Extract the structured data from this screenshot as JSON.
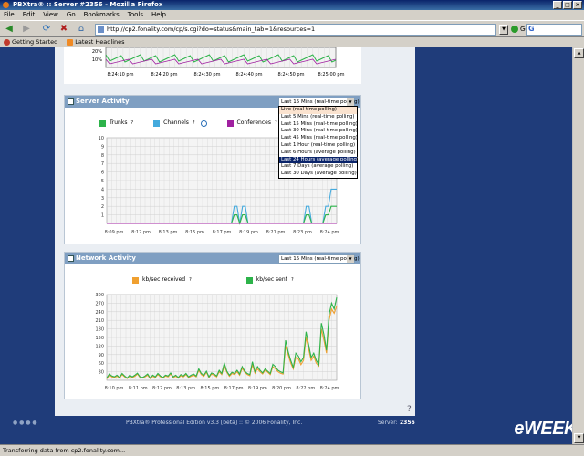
{
  "window": {
    "title": "PBXtra® :: Server #2356 - Mozilla Firefox"
  },
  "menu": [
    "File",
    "Edit",
    "View",
    "Go",
    "Bookmarks",
    "Tools",
    "Help"
  ],
  "toolbar": {
    "url": "http://cp2.fonality.com/cp/s.cgi?do=status&main_tab=1&resources=1",
    "go_label": "Go",
    "search_logo": "G"
  },
  "bookmarks": [
    {
      "label": "Getting Started",
      "icon": "firefox-icon"
    },
    {
      "label": "Latest Headlines",
      "icon": "rss-icon"
    }
  ],
  "top_chart": {
    "yticks": [
      "20%",
      "10%"
    ],
    "xticks": [
      "8:24:10 pm",
      "8:24:20 pm",
      "8:24:30 pm",
      "8:24:40 pm",
      "8:24:50 pm",
      "8:25:00 pm"
    ]
  },
  "server_activity": {
    "title": "Server Activity",
    "select_value": "Last 15 Mins (real-time polling)",
    "legend": [
      {
        "label": "Trunks",
        "color": "#2db34a",
        "help": "?"
      },
      {
        "label": "Channels",
        "color": "#44aadd",
        "help": "?"
      },
      {
        "label": "Conferences",
        "color": "#a020a0",
        "help": "?"
      }
    ],
    "dropdown_options": [
      "Live (real-time polling)",
      "Last 5 Mins (real-time polling)",
      "Last 15 Mins (real-time polling)",
      "Last 30 Mins (real-time polling)",
      "Last 45 Mins (real-time polling)",
      "Last 1 Hour (real-time polling)",
      "Last 6 Hours (average polling)",
      "Last 24 Hours (average polling)",
      "Last 7 Days (average polling)",
      "Last 30 Days (average polling)"
    ],
    "dropdown_selected_index": 7,
    "chart": {
      "ylim": [
        0,
        10
      ],
      "yticks": [
        "10",
        "9",
        "8",
        "7",
        "6",
        "5",
        "4",
        "3",
        "2",
        "1"
      ],
      "xticks": [
        "8:09 pm",
        "8:12 pm",
        "8:13 pm",
        "8:15 pm",
        "8:17 pm",
        "8:19 pm",
        "8:21 pm",
        "8:23 pm",
        "8:24 pm"
      ],
      "series": [
        {
          "name": "Channels",
          "color": "#44aadd",
          "values": [
            0,
            0,
            0,
            0,
            0,
            0,
            0,
            0,
            0,
            0,
            0,
            0,
            0,
            0,
            0,
            0,
            0,
            0,
            0,
            0,
            0,
            0,
            0,
            0,
            0,
            0,
            0,
            0,
            0,
            0,
            0,
            0,
            0,
            0,
            0,
            0,
            0,
            0,
            0,
            0,
            0,
            0,
            0,
            0,
            0,
            0,
            2,
            2,
            0,
            2,
            2,
            0,
            0,
            0,
            0,
            0,
            0,
            0,
            0,
            0,
            0,
            0,
            0,
            0,
            0,
            0,
            0,
            0,
            0,
            0,
            0,
            0,
            2,
            2,
            0,
            0,
            0,
            0,
            0,
            2,
            2,
            4,
            4,
            4
          ]
        },
        {
          "name": "Trunks",
          "color": "#2db34a",
          "values": [
            0,
            0,
            0,
            0,
            0,
            0,
            0,
            0,
            0,
            0,
            0,
            0,
            0,
            0,
            0,
            0,
            0,
            0,
            0,
            0,
            0,
            0,
            0,
            0,
            0,
            0,
            0,
            0,
            0,
            0,
            0,
            0,
            0,
            0,
            0,
            0,
            0,
            0,
            0,
            0,
            0,
            0,
            0,
            0,
            0,
            0,
            1,
            1,
            0,
            1,
            1,
            0,
            0,
            0,
            0,
            0,
            0,
            0,
            0,
            0,
            0,
            0,
            0,
            0,
            0,
            0,
            0,
            0,
            0,
            0,
            0,
            0,
            1,
            1,
            0,
            0,
            0,
            0,
            0,
            1,
            1,
            2,
            2,
            2
          ]
        },
        {
          "name": "Conferences",
          "color": "#a020a0",
          "values": [
            0,
            0,
            0,
            0,
            0,
            0,
            0,
            0,
            0,
            0,
            0,
            0,
            0,
            0,
            0,
            0,
            0,
            0,
            0,
            0,
            0,
            0,
            0,
            0,
            0,
            0,
            0,
            0,
            0,
            0,
            0,
            0,
            0,
            0,
            0,
            0,
            0,
            0,
            0,
            0,
            0,
            0,
            0,
            0,
            0,
            0,
            0,
            0,
            0,
            0,
            0,
            0,
            0,
            0,
            0,
            0,
            0,
            0,
            0,
            0,
            0,
            0,
            0,
            0,
            0,
            0,
            0,
            0,
            0,
            0,
            0,
            0,
            0,
            0,
            0,
            0,
            0,
            0,
            0,
            0,
            0,
            0,
            0,
            0
          ]
        }
      ]
    }
  },
  "network_activity": {
    "title": "Network Activity",
    "select_value": "Last 15 Mins (real-time polling)",
    "legend": [
      {
        "label": "kb/sec received",
        "color": "#f0a030",
        "help": "?"
      },
      {
        "label": "kb/sec sent",
        "color": "#2db34a",
        "help": "?"
      }
    ]
  },
  "footer": {
    "edition": "PBXtra® Professional Edition v3.3 [beta]  ::  © 2006 Fonality, Inc.",
    "server_label": "Server:",
    "server_number": "2356",
    "watermark": "eWEEK"
  },
  "status": {
    "text": "Transferring data from cp2.fonality.com..."
  },
  "chart_data": {
    "type": "line",
    "title": "",
    "xlabel": "",
    "ylabel": "",
    "ylim": [
      0,
      300
    ],
    "yticks": [
      "300",
      "270",
      "240",
      "210",
      "180",
      "150",
      "120",
      "90",
      "60",
      "30"
    ],
    "categories": [
      "8:10 pm",
      "8:11 pm",
      "8:12 pm",
      "8:13 pm",
      "8:15 pm",
      "8:17 pm",
      "8:19 pm",
      "8:20 pm",
      "8:22 pm",
      "8:24 pm"
    ],
    "series": [
      {
        "name": "kb/sec received",
        "color": "#f0a030",
        "values": [
          5,
          18,
          12,
          10,
          14,
          8,
          20,
          12,
          6,
          15,
          10,
          14,
          22,
          10,
          8,
          12,
          18,
          6,
          14,
          10,
          20,
          12,
          8,
          15,
          12,
          22,
          10,
          14,
          8,
          16,
          12,
          20,
          10,
          14,
          18,
          12,
          35,
          20,
          14,
          28,
          10,
          22,
          18,
          12,
          30,
          20,
          50,
          28,
          14,
          24,
          20,
          30,
          18,
          42,
          28,
          20,
          16,
          55,
          25,
          40,
          30,
          22,
          35,
          28,
          20,
          48,
          40,
          30,
          25,
          22,
          120,
          90,
          60,
          40,
          80,
          75,
          55,
          70,
          150,
          110,
          70,
          85,
          60,
          50,
          180,
          140,
          95,
          210,
          250,
          235,
          260
        ]
      },
      {
        "name": "kb/sec sent",
        "color": "#2db34a",
        "values": [
          8,
          22,
          15,
          12,
          18,
          10,
          24,
          15,
          8,
          18,
          12,
          18,
          25,
          12,
          10,
          15,
          22,
          8,
          18,
          12,
          24,
          15,
          10,
          18,
          15,
          26,
          12,
          18,
          10,
          20,
          15,
          24,
          12,
          18,
          22,
          15,
          40,
          24,
          18,
          32,
          12,
          26,
          22,
          15,
          35,
          24,
          60,
          32,
          18,
          28,
          24,
          35,
          22,
          48,
          32,
          24,
          20,
          65,
          30,
          48,
          35,
          26,
          40,
          32,
          24,
          56,
          48,
          35,
          30,
          26,
          140,
          100,
          70,
          45,
          95,
          85,
          65,
          80,
          170,
          125,
          80,
          95,
          70,
          55,
          200,
          160,
          105,
          230,
          270,
          250,
          290
        ]
      }
    ]
  }
}
